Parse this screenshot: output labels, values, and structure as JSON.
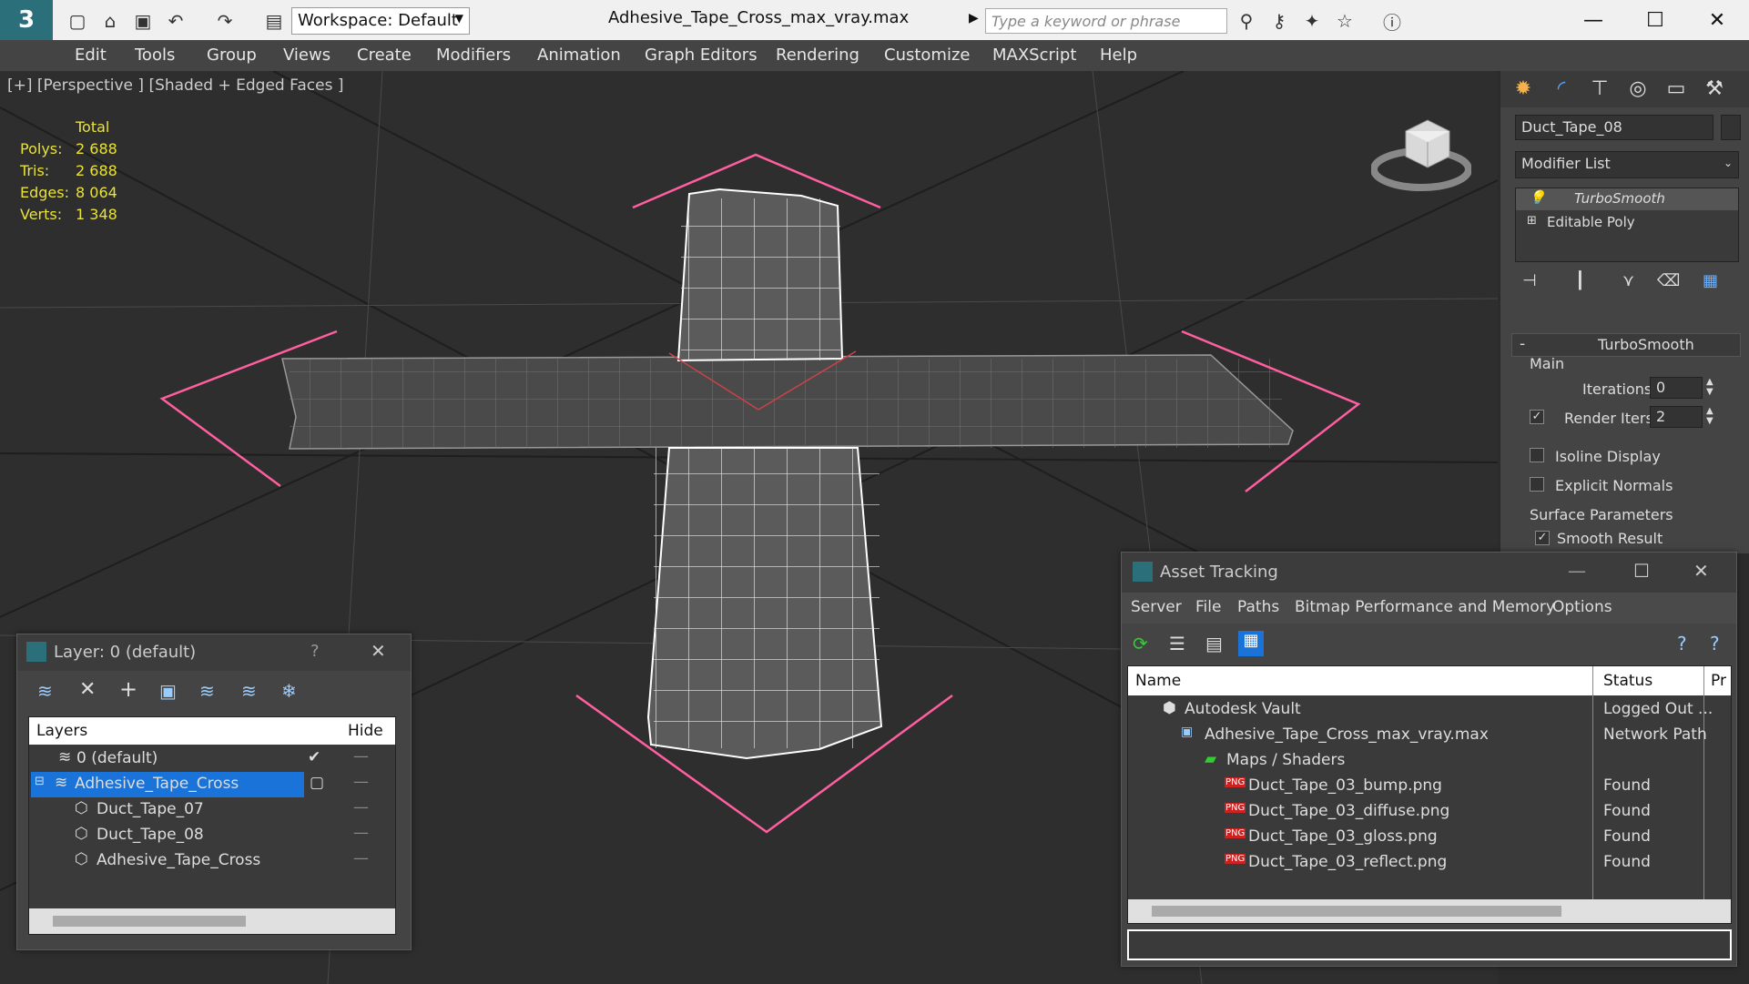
{
  "titlebar": {
    "file_title": "Adhesive_Tape_Cross_max_vray.max",
    "workspace_label": "Workspace: Default",
    "search_placeholder": "Type a keyword or phrase"
  },
  "menu": [
    "Edit",
    "Tools",
    "Group",
    "Views",
    "Create",
    "Modifiers",
    "Animation",
    "Graph Editors",
    "Rendering",
    "Customize",
    "MAXScript",
    "Help"
  ],
  "viewport": {
    "label": "[+] [Perspective ] [Shaded + Edged Faces ]",
    "stats": {
      "header": "Total",
      "rows": [
        {
          "k": "Polys:",
          "v": "2 688"
        },
        {
          "k": "Tris:",
          "v": "2 688"
        },
        {
          "k": "Edges:",
          "v": "8 064"
        },
        {
          "k": "Verts:",
          "v": "1 348"
        }
      ]
    }
  },
  "command_panel": {
    "object_name": "Duct_Tape_08",
    "modifier_list": "Modifier List",
    "stack": [
      "TurboSmooth",
      "Editable Poly"
    ],
    "rollout_title": "TurboSmooth",
    "main_label": "Main",
    "iterations_label": "Iterations:",
    "iterations_value": "0",
    "render_iters_label": "Render Iters:",
    "render_iters_value": "2",
    "isoline_label": "Isoline Display",
    "explicit_normals_label": "Explicit Normals",
    "surface_params_label": "Surface Parameters",
    "smooth_result_label": "Smooth Result"
  },
  "layer_dialog": {
    "title": "Layer: 0 (default)",
    "help": "?",
    "col_layers": "Layers",
    "col_hide": "Hide",
    "rows": [
      {
        "name": "0 (default)"
      },
      {
        "name": "Adhesive_Tape_Cross"
      },
      {
        "name": "Duct_Tape_07"
      },
      {
        "name": "Duct_Tape_08"
      },
      {
        "name": "Adhesive_Tape_Cross"
      }
    ]
  },
  "asset_dialog": {
    "title": "Asset Tracking",
    "menu": [
      "Server",
      "File",
      "Paths",
      "Bitmap Performance and Memory",
      "Options"
    ],
    "col_name": "Name",
    "col_status": "Status",
    "col_extra": "Pr",
    "rows": [
      {
        "name": "Autodesk Vault",
        "status": "Logged Out ..."
      },
      {
        "name": "Adhesive_Tape_Cross_max_vray.max",
        "status": "Network Path"
      },
      {
        "name": "Maps / Shaders",
        "status": ""
      },
      {
        "name": "Duct_Tape_03_bump.png",
        "status": "Found"
      },
      {
        "name": "Duct_Tape_03_diffuse.png",
        "status": "Found"
      },
      {
        "name": "Duct_Tape_03_gloss.png",
        "status": "Found"
      },
      {
        "name": "Duct_Tape_03_reflect.png",
        "status": "Found"
      }
    ]
  },
  "colors": {
    "accent": "#1a73d9",
    "stats": "#e9e23a",
    "selection": "#ff5fa0"
  }
}
